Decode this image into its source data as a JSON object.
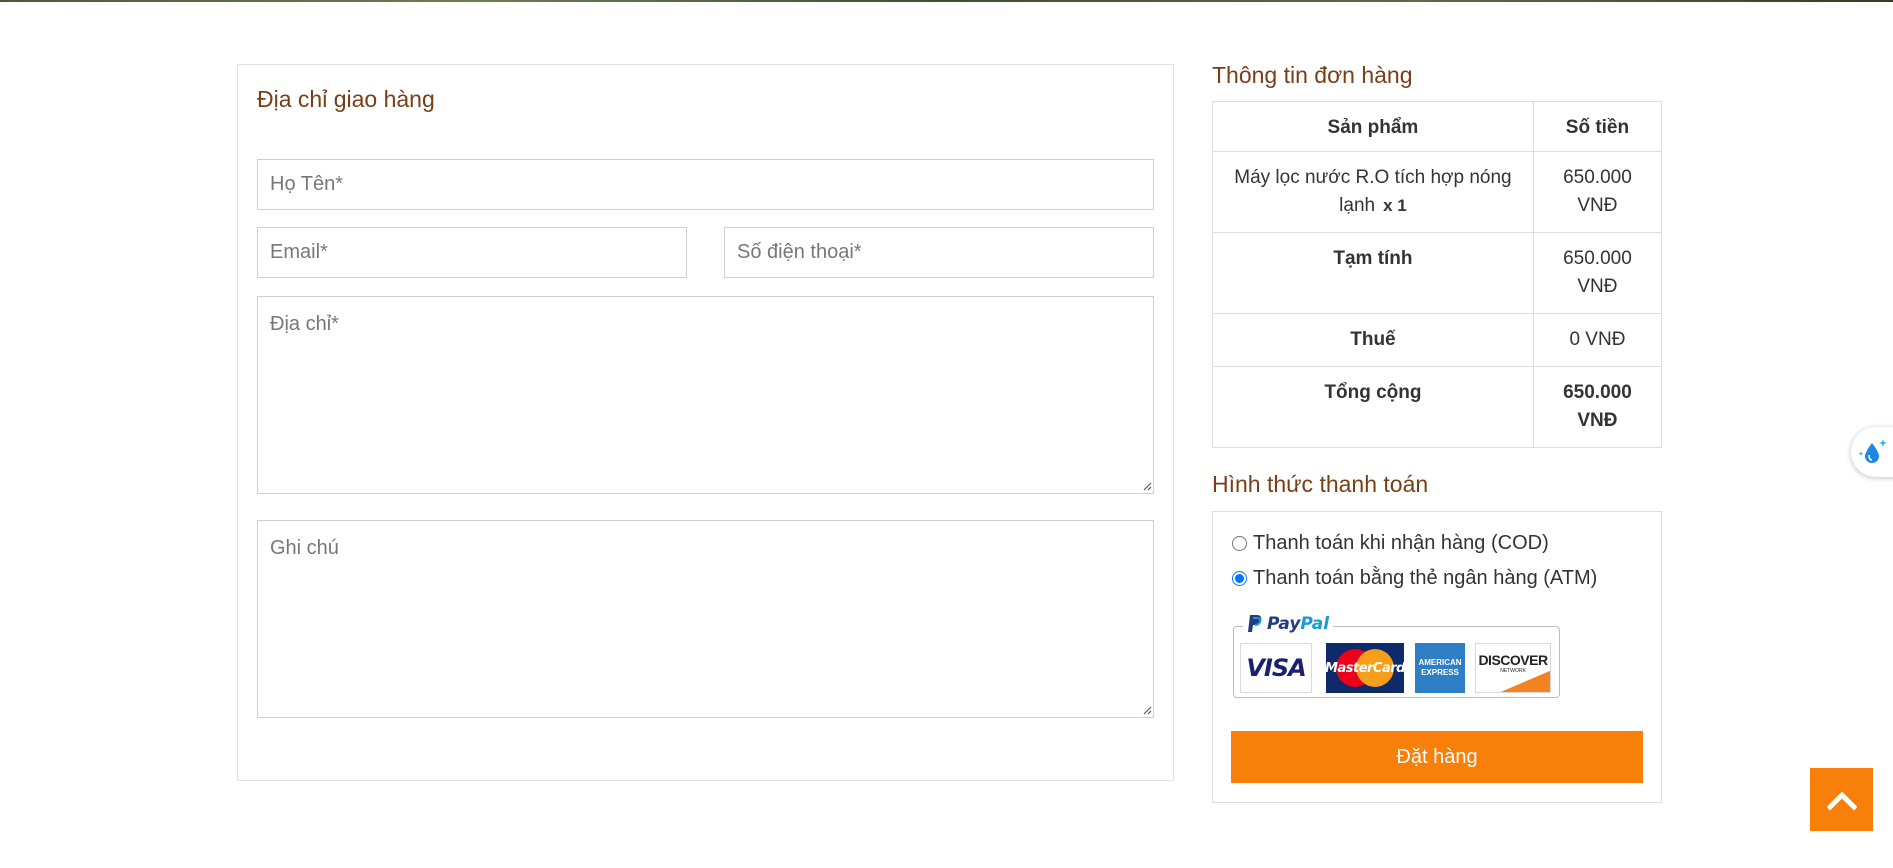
{
  "shipping": {
    "title": "Địa chỉ giao hàng",
    "name_placeholder": "Họ Tên*",
    "email_placeholder": "Email*",
    "phone_placeholder": "Số điện thoại*",
    "address_placeholder": "Địa chỉ*",
    "note_placeholder": "Ghi chú",
    "name_value": "",
    "email_value": "",
    "phone_value": "",
    "address_value": "",
    "note_value": ""
  },
  "order": {
    "title": "Thông tin đơn hàng",
    "headers": {
      "product": "Sản phẩm",
      "amount": "Số tiền"
    },
    "item": {
      "name": "Máy lọc nước R.O tích hợp nóng lạnh",
      "qty": "x 1",
      "price": "650.000 VNĐ"
    },
    "subtotal": {
      "label": "Tạm tính",
      "value": "650.000 VNĐ"
    },
    "tax": {
      "label": "Thuế",
      "value": "0 VNĐ"
    },
    "total": {
      "label": "Tổng cộng",
      "value": "650.000 VNĐ"
    }
  },
  "payment": {
    "title": "Hình thức thanh toán",
    "options": [
      {
        "label": "Thanh toán khi nhận hàng (COD)",
        "selected": false
      },
      {
        "label": "Thanh toán bằng thẻ ngân hàng (ATM)",
        "selected": true
      }
    ],
    "paypal": {
      "word_a": "Pay",
      "word_b": "Pal"
    },
    "cards": {
      "visa": "VISA",
      "mastercard": "MasterCard",
      "amex_top": "AMERICAN",
      "amex_bottom": "EXPRESS",
      "discover": "DISCOVER",
      "discover_sub": "NETWORK"
    },
    "submit_label": "Đặt hàng"
  },
  "colors": {
    "accent": "#f77f0a",
    "heading": "#7a3e17",
    "radio_selected": "#1a73e8"
  },
  "icons": {
    "side_widget": "water-drop-sparkle-icon",
    "scroll_top": "chevron-up-icon"
  }
}
